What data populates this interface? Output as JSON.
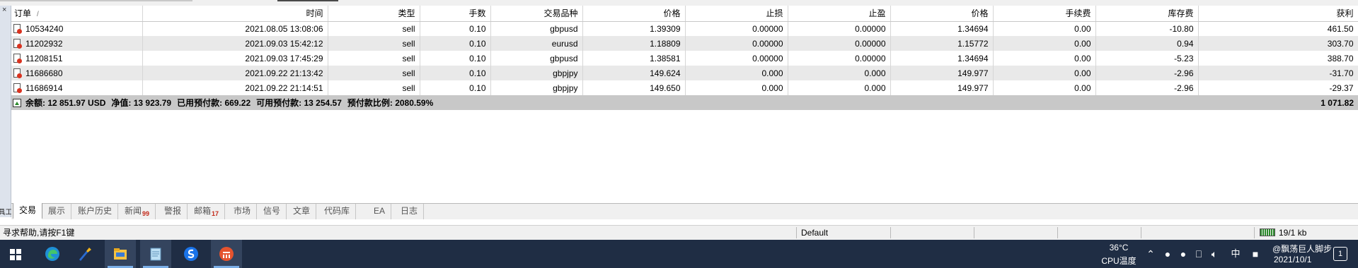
{
  "table": {
    "headers": [
      "订单",
      "时间",
      "类型",
      "手数",
      "交易品种",
      "价格",
      "止损",
      "止盈",
      "价格",
      "手续费",
      "库存费",
      "获利"
    ],
    "sort_indicator": "/",
    "rows": [
      {
        "order": "10534240",
        "time": "2021.08.05 13:08:06",
        "type": "sell",
        "volume": "0.10",
        "symbol": "gbpusd",
        "open_price": "1.39309",
        "sl": "0.00000",
        "tp": "0.00000",
        "price": "1.34694",
        "commission": "0.00",
        "swap": "-10.80",
        "profit": "461.50"
      },
      {
        "order": "11202932",
        "time": "2021.09.03 15:42:12",
        "type": "sell",
        "volume": "0.10",
        "symbol": "eurusd",
        "open_price": "1.18809",
        "sl": "0.00000",
        "tp": "0.00000",
        "price": "1.15772",
        "commission": "0.00",
        "swap": "0.94",
        "profit": "303.70"
      },
      {
        "order": "11208151",
        "time": "2021.09.03 17:45:29",
        "type": "sell",
        "volume": "0.10",
        "symbol": "gbpusd",
        "open_price": "1.38581",
        "sl": "0.00000",
        "tp": "0.00000",
        "price": "1.34694",
        "commission": "0.00",
        "swap": "-5.23",
        "profit": "388.70"
      },
      {
        "order": "11686680",
        "time": "2021.09.22 21:13:42",
        "type": "sell",
        "volume": "0.10",
        "symbol": "gbpjpy",
        "open_price": "149.624",
        "sl": "0.000",
        "tp": "0.000",
        "price": "149.977",
        "commission": "0.00",
        "swap": "-2.96",
        "profit": "-31.70"
      },
      {
        "order": "11686914",
        "time": "2021.09.22 21:14:51",
        "type": "sell",
        "volume": "0.10",
        "symbol": "gbpjpy",
        "open_price": "149.650",
        "sl": "0.000",
        "tp": "0.000",
        "price": "149.977",
        "commission": "0.00",
        "swap": "-2.96",
        "profit": "-29.37"
      }
    ],
    "summary": {
      "balance": "余额: 12 851.97 USD",
      "equity": "净值: 13 923.79",
      "margin": "已用预付款: 669.22",
      "free_margin": "可用预付款: 13 254.57",
      "margin_level": "预付款比例: 2080.59%",
      "total_profit": "1 071.82"
    }
  },
  "side_panel": {
    "close": "×",
    "label": "工具箱"
  },
  "tabs": [
    {
      "label": "交易",
      "active": true
    },
    {
      "label": "展示"
    },
    {
      "label": "账户历史"
    },
    {
      "label": "新闻",
      "badge": "99"
    },
    {
      "label": "警报"
    },
    {
      "label": "邮箱",
      "badge": "17"
    },
    {
      "label": "市场"
    },
    {
      "label": "信号"
    },
    {
      "label": "文章"
    },
    {
      "label": "代码库"
    },
    {
      "label": "EA"
    },
    {
      "label": "日志"
    }
  ],
  "status_bar": {
    "help": "寻求帮助,请按F1键",
    "profile": "Default",
    "connection": "19/1 kb"
  },
  "taskbar": {
    "apps": [
      "start-icon",
      "edge-icon",
      "paint-brush-icon",
      "file-explorer-icon",
      "notepad-icon",
      "sogou-icon",
      "trading-terminal-icon"
    ],
    "weather_temp": "36°C",
    "weather_label": "CPU温度",
    "ime": "中",
    "user": "@飘荡巨人脚步",
    "date": "2021/10/1",
    "notification_count": "1",
    "colors": {
      "taskbar_bg": "#1f2d44",
      "accent": "#7aaee6",
      "loss": "#d9321f",
      "profit_up": "#2b8a2b"
    }
  }
}
